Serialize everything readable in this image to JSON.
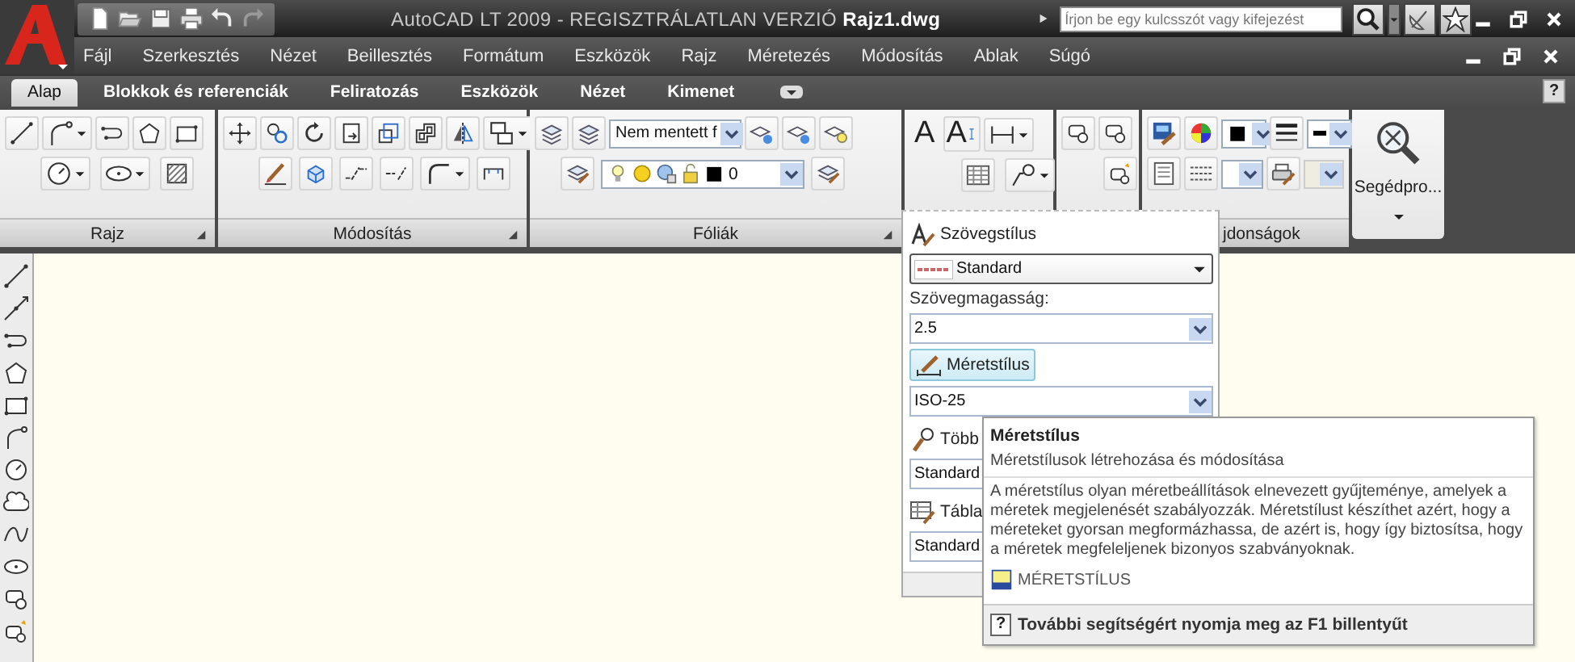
{
  "title_bar": {
    "title": "AutoCAD LT 2009 - REGISZTRÁLATLAN VERZIÓ **Rajz1.dwg**",
    "search": {
      "placeholder": "Írjon be egy kulcsszót vagy kifejezést"
    }
  },
  "menu": [
    "Fájl",
    "Szerkesztés",
    "Nézet",
    "Beillesztés",
    "Formátum",
    "Eszközök",
    "Rajz",
    "Méretezés",
    "Módosítás",
    "Ablak",
    "Súgó"
  ],
  "ribbon_tabs": [
    {
      "label": "Alap",
      "selected": true
    },
    {
      "label": "Blokkok és referenciák",
      "selected": false
    },
    {
      "label": "Feliratozás",
      "selected": false
    },
    {
      "label": "Eszközök",
      "selected": false
    },
    {
      "label": "Nézet",
      "selected": false
    },
    {
      "label": "Kimenet",
      "selected": false
    }
  ],
  "ribbon_help": "?",
  "panels": [
    {
      "kind": "draw",
      "label": "Rajz"
    },
    {
      "kind": "modify",
      "label": "Módosítás"
    },
    {
      "kind": "layers",
      "label": "Fóliák",
      "layer_state": "Nem mentett f",
      "layer": "0"
    },
    {
      "kind": "annotation",
      "text_glyphs": [
        "A",
        "A"
      ]
    },
    {
      "kind": "block"
    },
    {
      "kind": "properties",
      "label": "jdonságok"
    },
    {
      "kind": "utilities",
      "label": "Segédpro..."
    }
  ],
  "dropdown": {
    "items": [
      {
        "kind": "heading",
        "label": "Szövegstílus"
      },
      {
        "kind": "combo",
        "value": "Standard",
        "preview": true
      },
      {
        "kind": "label",
        "label": "Szövegmagasság:"
      },
      {
        "kind": "combo",
        "value": "2.5",
        "preview": false
      },
      {
        "kind": "button",
        "label": "Méretstílus",
        "hovered": true
      },
      {
        "kind": "combo",
        "value": "ISO-25",
        "preview": false
      },
      {
        "kind": "heading",
        "label": "Több"
      },
      {
        "kind": "covered_combo",
        "value": "Standard"
      },
      {
        "kind": "heading",
        "label": "Tábla"
      },
      {
        "kind": "covered_combo",
        "value": "Standard"
      }
    ]
  },
  "tooltip": {
    "title": "Méretstílus",
    "summary": "Méretstílusok létrehozása és módosítása",
    "description": "A méretstílus olyan méretbeállítások elnevezett gyűjteménye, amelyek a méretek megjelenését szabályozzák. Méretstílust készíthet azért, hogy a méreteket gyorsan megformázhassa, de azért is, hogy így biztosítsa, hogy a méretek megfeleljenek bizonyos szabványoknak.",
    "command": "MÉRETSTÍLUS",
    "help_key": "?",
    "help": "További segítségért nyomja meg az F1 billentyűt"
  }
}
